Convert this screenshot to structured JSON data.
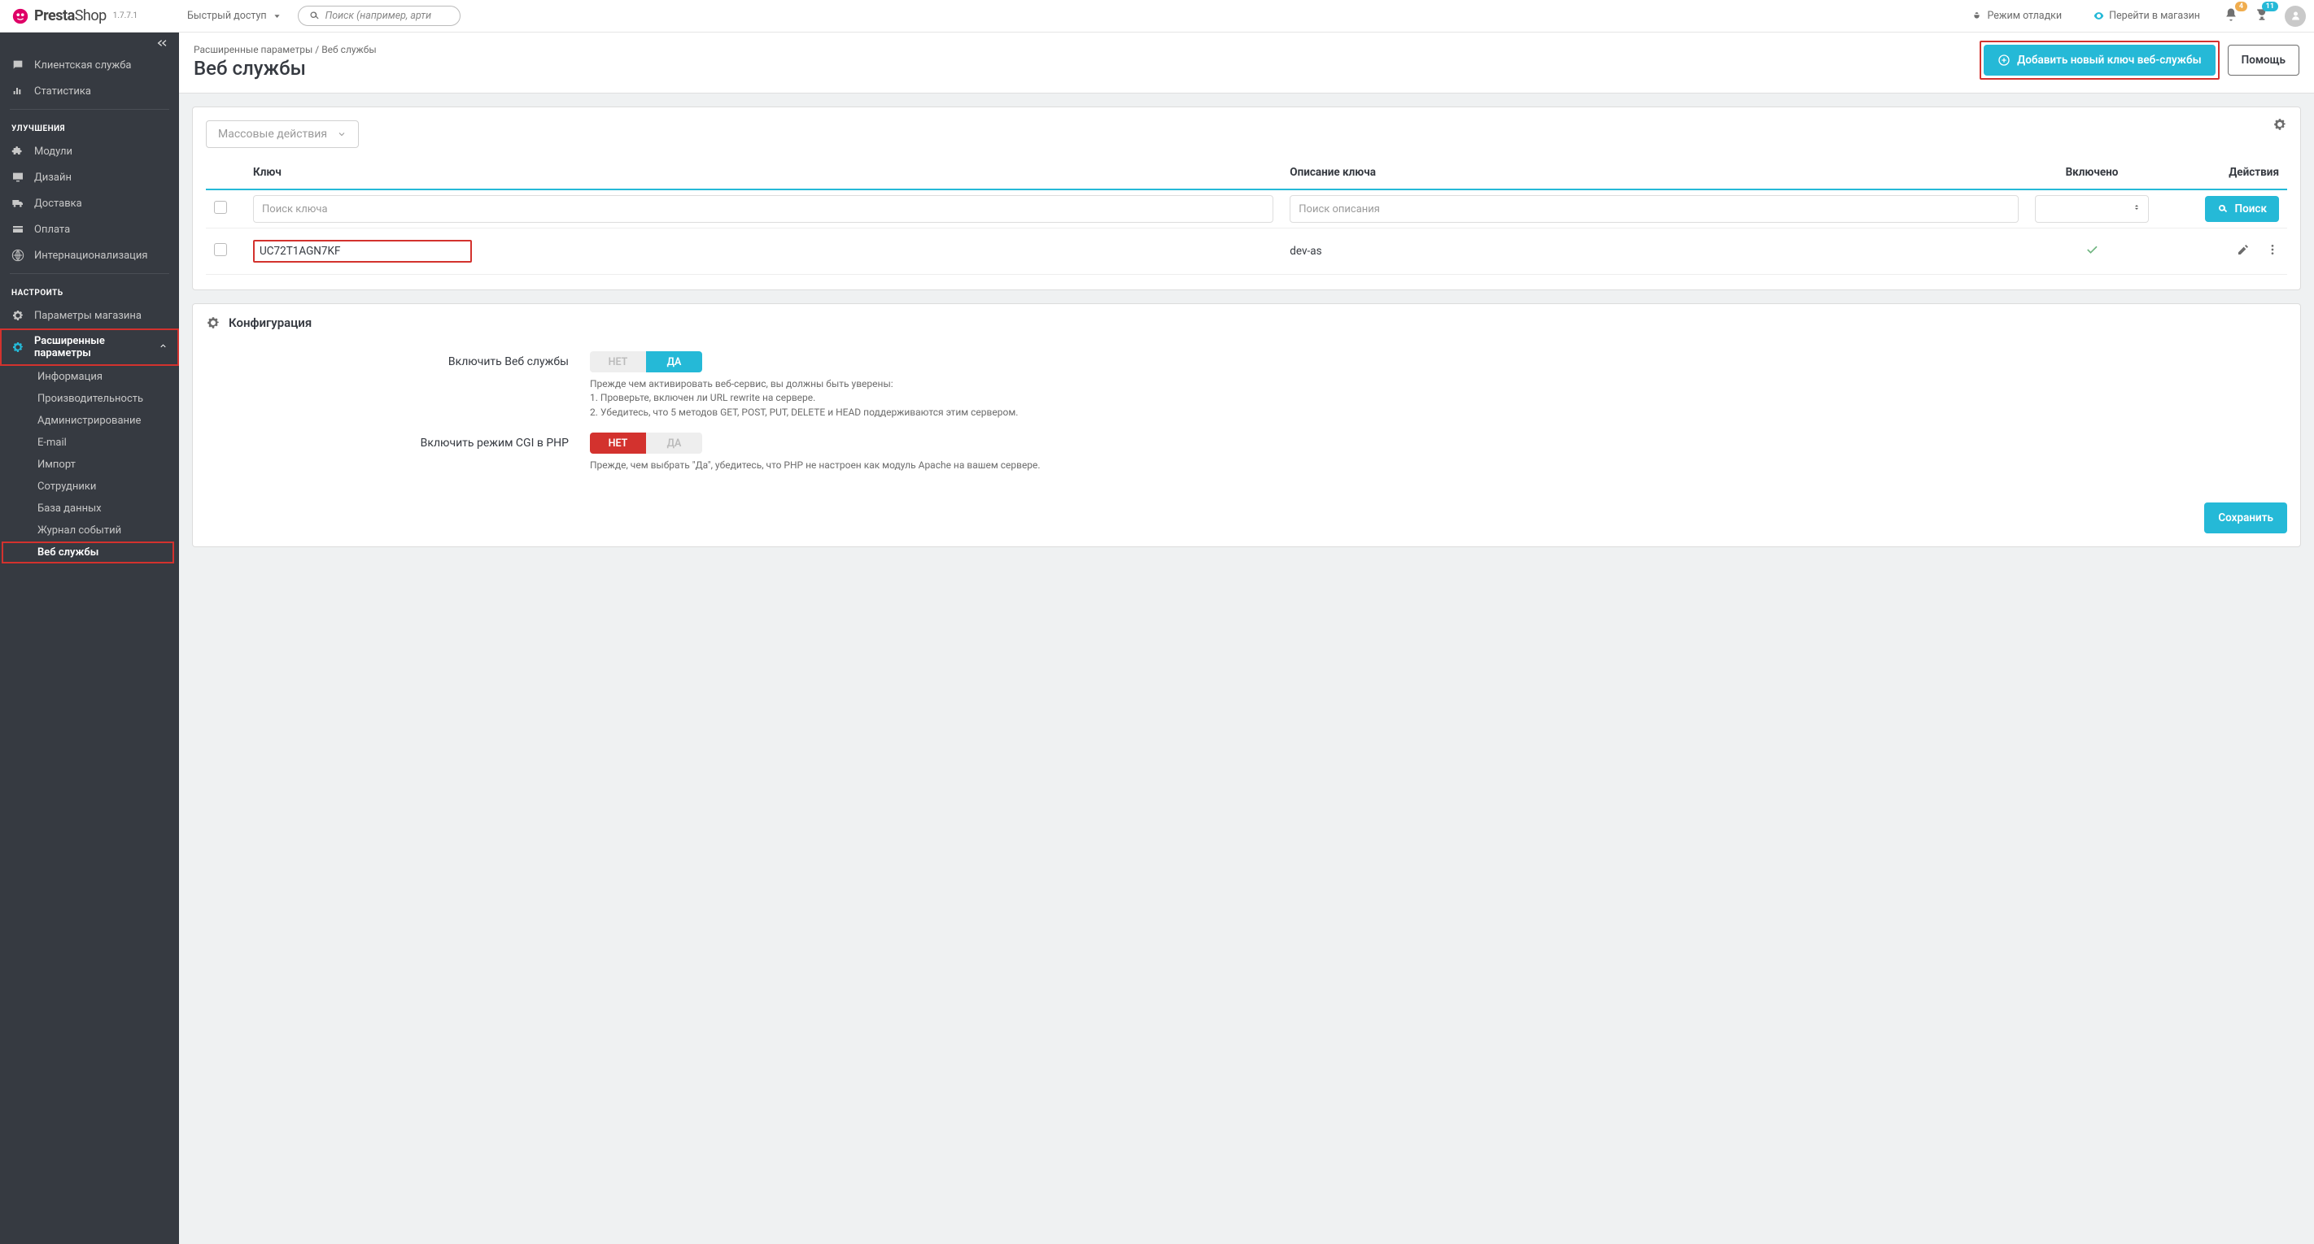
{
  "brand": {
    "name_a": "Presta",
    "name_b": "Shop",
    "version": "1.7.7.1"
  },
  "topbar": {
    "quick_access": "Быстрый доступ",
    "search_placeholder": "Поиск (например, арти",
    "debug_mode": "Режим отладки",
    "view_store": "Перейти в магазин",
    "notif_badge": "4",
    "cart_badge": "11"
  },
  "sidebar": {
    "group_top": [
      {
        "label": "Клиентская служба",
        "icon": "chat"
      },
      {
        "label": "Статистика",
        "icon": "stats"
      }
    ],
    "heading_improve": "УЛУЧШЕНИЯ",
    "group_improve": [
      {
        "label": "Модули",
        "icon": "puzzle"
      },
      {
        "label": "Дизайн",
        "icon": "desktop"
      },
      {
        "label": "Доставка",
        "icon": "truck"
      },
      {
        "label": "Оплата",
        "icon": "card"
      },
      {
        "label": "Интернационализация",
        "icon": "globe"
      }
    ],
    "heading_configure": "НАСТРОИТЬ",
    "group_configure": [
      {
        "label": "Параметры магазина",
        "icon": "gear"
      },
      {
        "label": "Расширенные параметры",
        "icon": "gear2"
      }
    ],
    "submenu_adv": [
      "Информация",
      "Производительность",
      "Администрирование",
      "E-mail",
      "Импорт",
      "Сотрудники",
      "База данных",
      "Журнал событий",
      "Веб службы"
    ]
  },
  "header": {
    "breadcrumb_a": "Расширенные параметры",
    "breadcrumb_b": "Веб службы",
    "title": "Веб службы",
    "add_btn": "Добавить новый ключ веб-службы",
    "help_btn": "Помощь"
  },
  "listing": {
    "bulk_label": "Массовые действия",
    "cols": {
      "key": "Ключ",
      "desc": "Описание ключа",
      "enabled": "Включено",
      "actions": "Действия"
    },
    "filters": {
      "key_ph": "Поиск ключа",
      "desc_ph": "Поиск описания",
      "search_btn": "Поиск"
    },
    "rows": [
      {
        "key": "UC72T1AGN7KF",
        "desc": "dev-as"
      }
    ]
  },
  "config": {
    "title": "Конфигурация",
    "enable_ws_label": "Включить Веб службы",
    "enable_ws_help": "Прежде чем активировать веб-сервис, вы должны быть уверены:\n1. Проверьте, включен ли URL rewrite на сервере.\n2. Убедитесь, что 5 методов GET, POST, PUT, DELETE и HEAD поддерживаются этим сервером.",
    "cgi_label": "Включить режим CGI в PHP",
    "cgi_help": "Прежде, чем выбрать \"Да\", убедитесь, что PHP не настроен как модуль Apache на вашем сервере.",
    "no": "НЕТ",
    "yes": "ДА",
    "save": "Сохранить"
  }
}
